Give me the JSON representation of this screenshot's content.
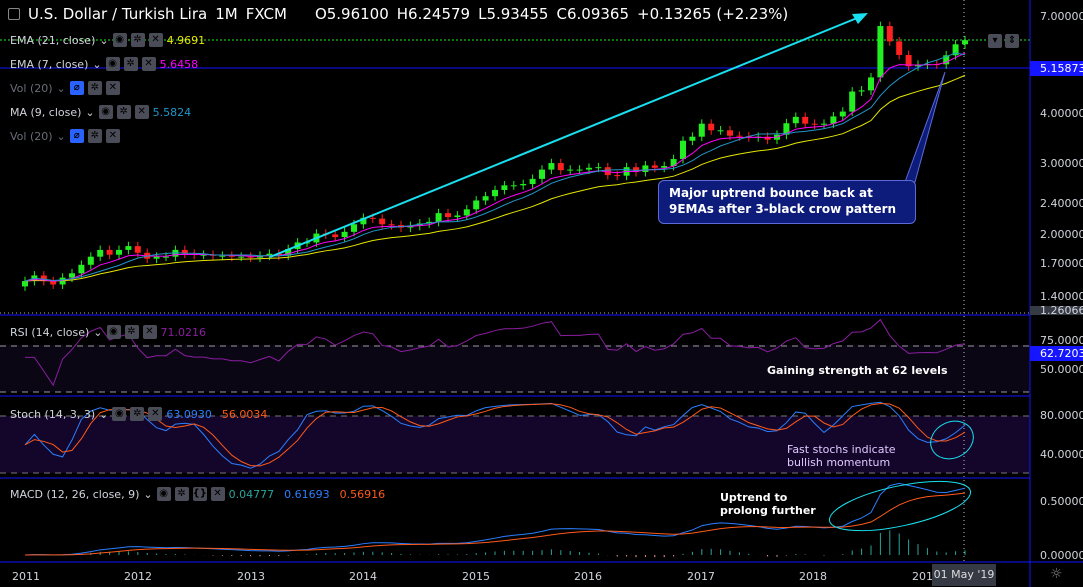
{
  "header": {
    "symbol": "U.S. Dollar / Turkish Lira",
    "interval": "1M",
    "source": "FXCM",
    "open": "O5.96100",
    "high": "H6.24579",
    "low": "L5.93455",
    "close": "C6.09365",
    "change": "+0.13265 (+2.23%)"
  },
  "indicators": [
    {
      "label": "EMA (21, close)",
      "value": "4.9691",
      "color": "#e6e600"
    },
    {
      "label": "EMA (7, close)",
      "value": "5.6458",
      "color": "#ff00ff"
    },
    {
      "label": "Vol (20)",
      "value": "",
      "color": ""
    },
    {
      "label": "MA (9, close)",
      "value": "5.5824",
      "color": "#2196c8"
    },
    {
      "label": "Vol (20)",
      "value": "",
      "color": ""
    }
  ],
  "rsi": {
    "label": "RSI (14, close)",
    "value": "71.0216"
  },
  "stoch": {
    "label": "Stoch (14, 3, 3)",
    "k": "63.0930",
    "d": "56.0034"
  },
  "macd": {
    "label": "MACD (12, 26, close, 9)",
    "hist": "0.04777",
    "macd": "0.61693",
    "signal": "0.56916"
  },
  "price_axis": [
    "7.00000",
    "4.00000",
    "3.00000",
    "2.40000",
    "2.00000",
    "1.70000",
    "1.40000",
    "1.26066"
  ],
  "price_tag": "5.15873",
  "rsi_axis": [
    "75.0000",
    "50.0000"
  ],
  "rsi_tag": "62.7203",
  "stoch_axis": [
    "80.0000",
    "40.0000"
  ],
  "macd_axis": [
    "0.50000",
    "0.00000"
  ],
  "x_axis": [
    "2011",
    "2012",
    "2013",
    "2014",
    "2015",
    "2016",
    "2017",
    "2018",
    "201"
  ],
  "date_tag": "01 May '19",
  "annotations": {
    "callout": [
      "Major uptrend bounce back at",
      "9EMAs after 3-black crow pattern"
    ],
    "rsi_note": "Gaining strength at 62 levels",
    "stoch_note": [
      "Fast stochs indicate",
      "bullish momentum"
    ],
    "macd_note": [
      "Uptrend to",
      "prolong further"
    ]
  },
  "colors": {
    "up": "#22ee22",
    "down": "#ff2020",
    "ema21": "#e6e600",
    "ema7": "#ff00ff",
    "ma9": "#2196c8",
    "rsi": "#8a1ea0",
    "stochK": "#2a7fff",
    "stochD": "#ff5a1a"
  },
  "closes": [
    1.55,
    1.6,
    1.55,
    1.52,
    1.58,
    1.62,
    1.7,
    1.78,
    1.85,
    1.8,
    1.85,
    1.89,
    1.82,
    1.76,
    1.78,
    1.78,
    1.85,
    1.81,
    1.8,
    1.8,
    1.79,
    1.79,
    1.78,
    1.78,
    1.77,
    1.79,
    1.81,
    1.79,
    1.86,
    1.93,
    1.93,
    2.03,
    2.02,
    1.99,
    2.05,
    2.14,
    2.22,
    2.21,
    2.14,
    2.13,
    2.1,
    2.12,
    2.15,
    2.17,
    2.28,
    2.23,
    2.25,
    2.33,
    2.45,
    2.51,
    2.6,
    2.67,
    2.67,
    2.69,
    2.77,
    2.92,
    3.03,
    2.91,
    2.92,
    2.92,
    2.95,
    2.96,
    2.83,
    2.82,
    2.96,
    2.88,
    2.99,
    2.95,
    2.98,
    3.1,
    3.44,
    3.52,
    3.79,
    3.65,
    3.65,
    3.54,
    3.53,
    3.51,
    3.52,
    3.46,
    3.56,
    3.8,
    3.94,
    3.79,
    3.77,
    3.79,
    3.95,
    4.06,
    4.55,
    4.58,
    4.93,
    6.6,
    6.05,
    5.6,
    5.25,
    5.3,
    5.32,
    5.31,
    5.59,
    5.95,
    6.09
  ]
}
